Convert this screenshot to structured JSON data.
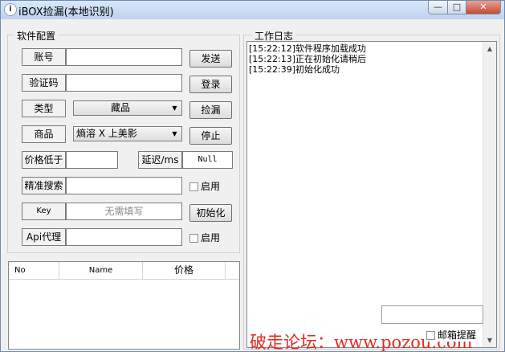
{
  "window": {
    "title": "iBOX捡漏(本地识别)",
    "icon_text": "i",
    "min_symbol": "—",
    "max_symbol": "□",
    "close_symbol": "✕"
  },
  "config": {
    "group_label": "软件配置",
    "account_label": "账号",
    "account_value": "",
    "captcha_label": "验证码",
    "captcha_value": "",
    "type_label": "类型",
    "type_selected": "藏品",
    "product_label": "商品",
    "product_selected": "熵溶 X 上美影",
    "price_label": "价格低于",
    "price_value": "",
    "delay_label": "延迟/ms",
    "delay_value": "Null",
    "search_label": "精准搜索",
    "search_value": "",
    "enable_label_1": "启用",
    "key_label": "Key",
    "key_placeholder": "无需填写",
    "api_label": "Api代理",
    "api_value": "",
    "enable_label_2": "启用"
  },
  "buttons": {
    "send": "发送",
    "login": "登录",
    "snipe": "捡漏",
    "stop": "停止",
    "init": "初始化"
  },
  "table": {
    "columns": [
      "No",
      "Name",
      "价格"
    ],
    "rows": []
  },
  "log": {
    "group_label": "工作日志",
    "lines": [
      "[15:22:12]软件程序加载成功",
      "[15:22:13]正在初始化请稍后",
      "[15:22:39]初始化成功"
    ],
    "mail_alert_label": "邮箱提醒"
  },
  "watermark": {
    "text": "破走论坛：www.pozou.com"
  },
  "icons": {
    "dropdown": "chevron-down-icon",
    "scroll_up": "scroll-up-icon",
    "scroll_down": "scroll-down-icon"
  }
}
